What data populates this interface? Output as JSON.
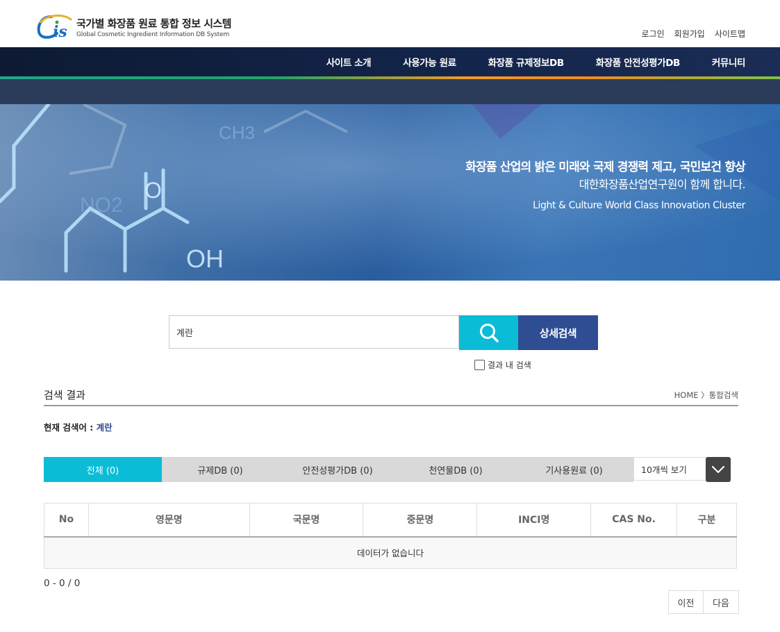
{
  "header": {
    "logo_mark": "Cis",
    "logo_title": "국가별 화장품 원료 통합 정보 시스템",
    "logo_subtitle": "Global Cosmetic Ingredient Information DB System",
    "util_links": [
      "로그인",
      "회원가입",
      "사이트맵"
    ]
  },
  "nav": {
    "items": [
      "사이트 소개",
      "사용가능 원료",
      "화장품 규제정보DB",
      "화장품 안전성평가DB",
      "커뮤니티"
    ]
  },
  "hero": {
    "line1": "화장품 산업의 밝은 미래와 국제 경쟁력 제고, 국민보건 향상",
    "line2": "대한화장품산업연구원이 함께 합니다.",
    "line3": "Light & Culture World Class Innovation Cluster",
    "molecule_labels": [
      "O",
      "OH",
      "CH3",
      "NO2"
    ]
  },
  "search": {
    "value": "계란",
    "advanced_label": "상세검색",
    "within_label": "결과 내 검색",
    "within_checked": false
  },
  "results": {
    "title": "검색 결과",
    "breadcrumb": "HOME 〉통합검색",
    "current_term_label": "현재 검색어 : ",
    "current_term": "계란",
    "tabs": [
      "전체 (0)",
      "규제DB (0)",
      "안전성평가DB (0)",
      "천연물DB (0)",
      "기사용원료 (0)"
    ],
    "active_tab": 0,
    "per_page": "10개씩 보기",
    "columns": [
      "No",
      "영문명",
      "국문명",
      "중문명",
      "INCI명",
      "CAS No.",
      "구분"
    ],
    "empty_message": "데이터가 없습니다",
    "count_text": "0 - 0 / 0",
    "prev_label": "이전",
    "next_label": "다음"
  },
  "colors": {
    "accent_cyan": "#0bbcd6",
    "accent_navy": "#2f4d93",
    "nav_bg": "#13244a"
  }
}
